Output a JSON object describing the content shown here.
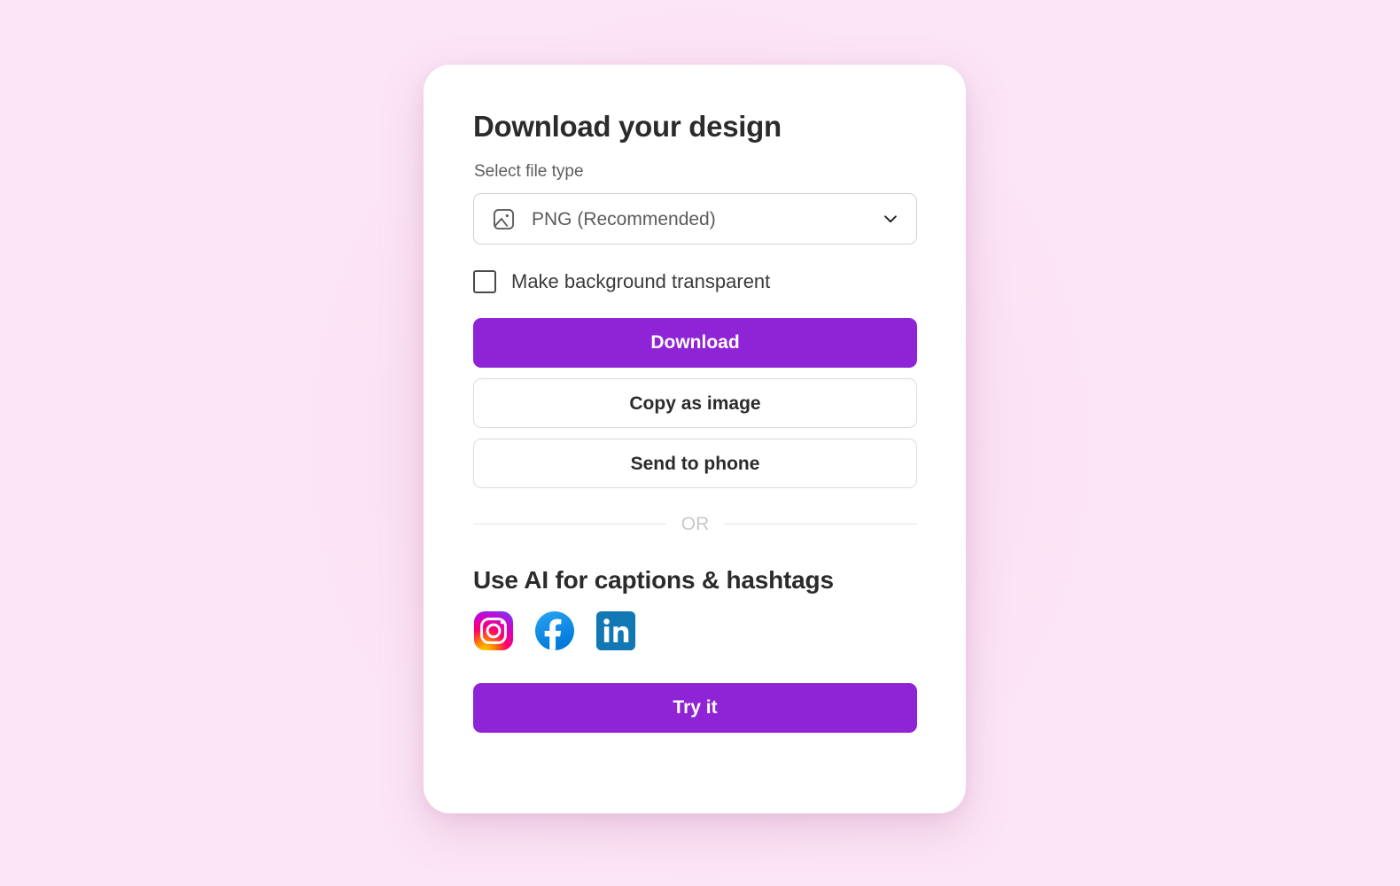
{
  "theme": {
    "page_background": "#FCE5F6",
    "card_background": "#FFFFFF",
    "primary_button_color": "#8F23D6",
    "primary_button_text_color": "#FFFFFF",
    "text_color": "#2B2B2B",
    "muted_text_color": "#5E5E5E",
    "divider_color": "#E3E3E3"
  },
  "dialog": {
    "title": "Download your design",
    "file_type": {
      "label": "Select file type",
      "icon": "image-icon",
      "selected_value": "PNG (Recommended)",
      "dropdown_icon": "chevron-down-icon",
      "options": [
        "PNG (Recommended)"
      ]
    },
    "transparency": {
      "label": "Make background transparent",
      "checked": false
    },
    "actions": {
      "download_label": "Download",
      "copy_label": "Copy as image",
      "send_label": "Send to phone"
    },
    "divider_text": "OR",
    "ai_section": {
      "title": "Use AI for captions & hashtags",
      "socials": [
        {
          "name": "instagram-icon",
          "label": "Instagram"
        },
        {
          "name": "facebook-icon",
          "label": "Facebook"
        },
        {
          "name": "linkedin-icon",
          "label": "LinkedIn"
        }
      ],
      "try_label": "Try it"
    }
  }
}
